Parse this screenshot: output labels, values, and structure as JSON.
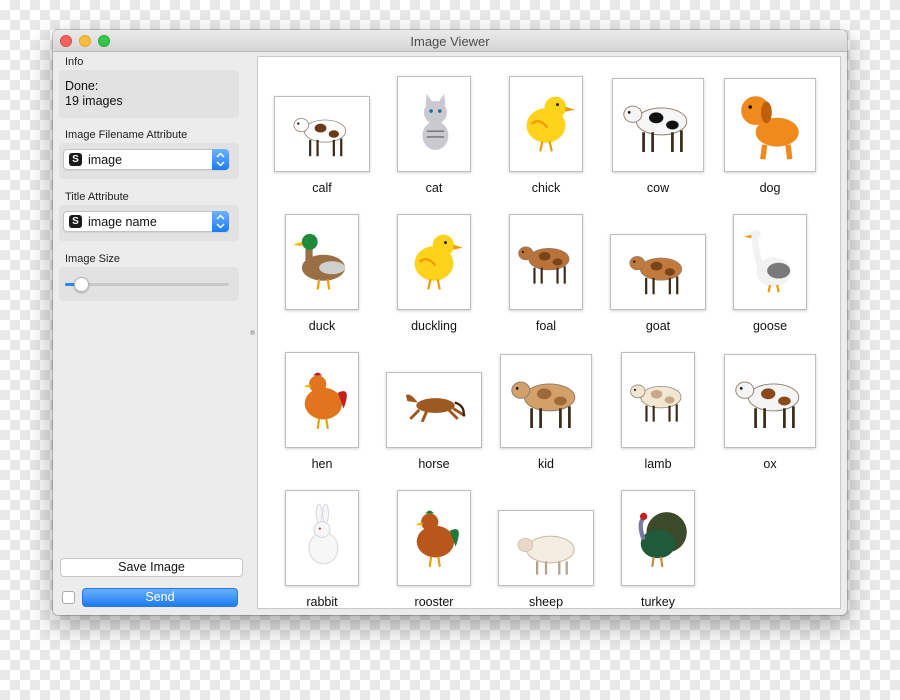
{
  "window": {
    "title": "Image Viewer"
  },
  "sidebar": {
    "info_label": "Info",
    "info_line1": "Done:",
    "info_line2": "19 images",
    "filename_label": "Image Filename Attribute",
    "filename_value": "image",
    "title_label": "Title Attribute",
    "title_value": "image name",
    "size_label": "Image Size",
    "size_fraction": 0.1,
    "save_label": "Save Image",
    "send_label": "Send",
    "auto_send_checked": false
  },
  "images": [
    {
      "name": "calf",
      "body": "#ffffff",
      "spot": "#6b3a17",
      "kind": "quad"
    },
    {
      "name": "cat",
      "body": "#c9c9cf",
      "spot": "#6e6e78",
      "kind": "cat"
    },
    {
      "name": "chick",
      "body": "#ffd21c",
      "spot": "#f39a00",
      "kind": "bird"
    },
    {
      "name": "cow",
      "body": "#f6f6f6",
      "spot": "#111111",
      "kind": "quad"
    },
    {
      "name": "dog",
      "body": "#f08a1d",
      "spot": "#c0600d",
      "kind": "dog"
    },
    {
      "name": "duck",
      "body": "#9b6f45",
      "spot": "#1f8a3a",
      "kind": "duck"
    },
    {
      "name": "duckling",
      "body": "#ffd21c",
      "spot": "#f39a00",
      "kind": "bird"
    },
    {
      "name": "foal",
      "body": "#b9733a",
      "spot": "#7a4419",
      "kind": "quad"
    },
    {
      "name": "goat",
      "body": "#c27a3c",
      "spot": "#7a4419",
      "kind": "quad"
    },
    {
      "name": "goose",
      "body": "#f2f2f2",
      "spot": "#7a7a7a",
      "kind": "goose"
    },
    {
      "name": "hen",
      "body": "#e0751e",
      "spot": "#c41e1e",
      "kind": "hen"
    },
    {
      "name": "horse",
      "body": "#9c5a22",
      "spot": "#3b2210",
      "kind": "horse"
    },
    {
      "name": "kid",
      "body": "#d4a06a",
      "spot": "#9c6a38",
      "kind": "quad"
    },
    {
      "name": "lamb",
      "body": "#f1e7d2",
      "spot": "#caa98a",
      "kind": "quad"
    },
    {
      "name": "ox",
      "body": "#f5f5f5",
      "spot": "#8b4a1c",
      "kind": "quad"
    },
    {
      "name": "rabbit",
      "body": "#f7f7f7",
      "spot": "#d9d9e2",
      "kind": "rabbit"
    },
    {
      "name": "rooster",
      "body": "#b8561c",
      "spot": "#1f7a3a",
      "kind": "hen"
    },
    {
      "name": "sheep",
      "body": "#f3ede2",
      "spot": "#cbbfa8",
      "kind": "sheep"
    },
    {
      "name": "turkey",
      "body": "#1f5a3a",
      "spot": "#c41e1e",
      "kind": "turkey"
    }
  ]
}
